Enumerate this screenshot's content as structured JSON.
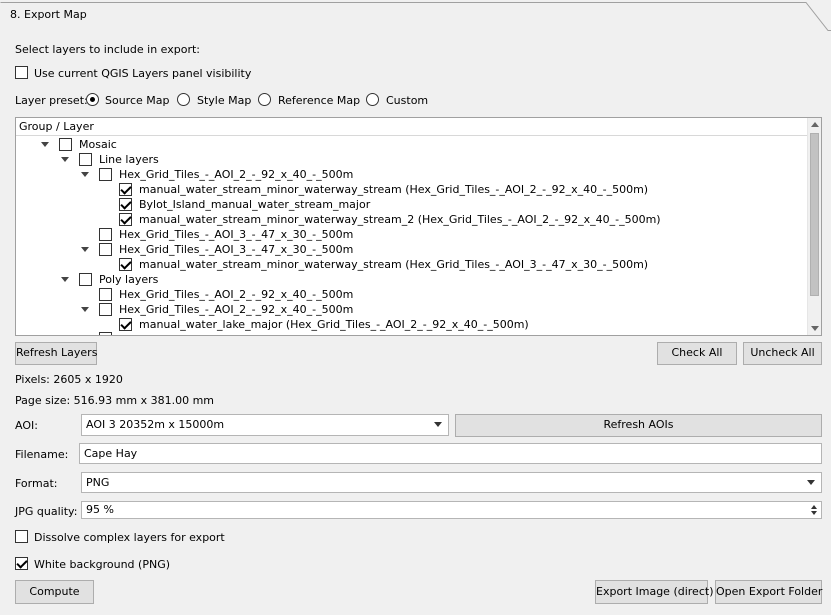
{
  "panel": {
    "title": "8. Export Map"
  },
  "select_label": "Select layers to include in export:",
  "use_visibility": {
    "label": "Use current QGIS Layers panel visibility",
    "checked": false
  },
  "preset": {
    "label": "Layer preset:",
    "options": [
      "Source Map",
      "Style Map",
      "Reference Map",
      "Custom"
    ],
    "selected": "Source Map"
  },
  "tree": {
    "header": "Group / Layer",
    "rows": [
      {
        "text": "Mosaic",
        "checked": false,
        "expandable": true
      },
      {
        "text": "Line layers",
        "checked": false,
        "expandable": true
      },
      {
        "text": "Hex_Grid_Tiles_-_AOI_2_-_92_x_40_-_500m",
        "checked": false,
        "expandable": true
      },
      {
        "text": "manual_water_stream_minor_waterway_stream (Hex_Grid_Tiles_-_AOI_2_-_92_x_40_-_500m)",
        "checked": true,
        "expandable": false
      },
      {
        "text": "Bylot_Island_manual_water_stream_major",
        "checked": true,
        "expandable": false
      },
      {
        "text": "manual_water_stream_minor_waterway_stream_2 (Hex_Grid_Tiles_-_AOI_2_-_92_x_40_-_500m)",
        "checked": true,
        "expandable": false
      },
      {
        "text": "Hex_Grid_Tiles_-_AOI_3_-_47_x_30_-_500m",
        "checked": false,
        "expandable": false
      },
      {
        "text": "Hex_Grid_Tiles_-_AOI_3_-_47_x_30_-_500m",
        "checked": false,
        "expandable": true
      },
      {
        "text": "manual_water_stream_minor_waterway_stream (Hex_Grid_Tiles_-_AOI_3_-_47_x_30_-_500m)",
        "checked": true,
        "expandable": false
      },
      {
        "text": "Poly layers",
        "checked": false,
        "expandable": true
      },
      {
        "text": "Hex_Grid_Tiles_-_AOI_2_-_92_x_40_-_500m",
        "checked": false,
        "expandable": false
      },
      {
        "text": "Hex_Grid_Tiles_-_AOI_2_-_92_x_40_-_500m",
        "checked": false,
        "expandable": true
      },
      {
        "text": "manual_water_lake_major (Hex_Grid_Tiles_-_AOI_2_-_92_x_40_-_500m)",
        "checked": true,
        "expandable": false
      }
    ]
  },
  "buttons": {
    "refresh_layers": "Refresh Layers",
    "check_all": "Check All",
    "uncheck_all": "Uncheck All",
    "refresh_aois": "Refresh AOIs",
    "compute": "Compute",
    "export_image": "Export Image (direct)",
    "open_folder": "Open Export Folder"
  },
  "info": {
    "pixels": "Pixels: 2605 x 1920",
    "page_size": "Page size: 516.93 mm x 381.00 mm"
  },
  "aoi": {
    "label": "AOI:",
    "value": "AOI 3 20352m x 15000m"
  },
  "filename": {
    "label": "Filename:",
    "value": "Cape Hay"
  },
  "format": {
    "label": "Format:",
    "value": "PNG"
  },
  "jpg_quality": {
    "label": "JPG quality:",
    "value": "95 %"
  },
  "dissolve": {
    "label": "Dissolve complex layers for export",
    "checked": false
  },
  "white_bg": {
    "label": "White background (PNG)",
    "checked": true
  }
}
